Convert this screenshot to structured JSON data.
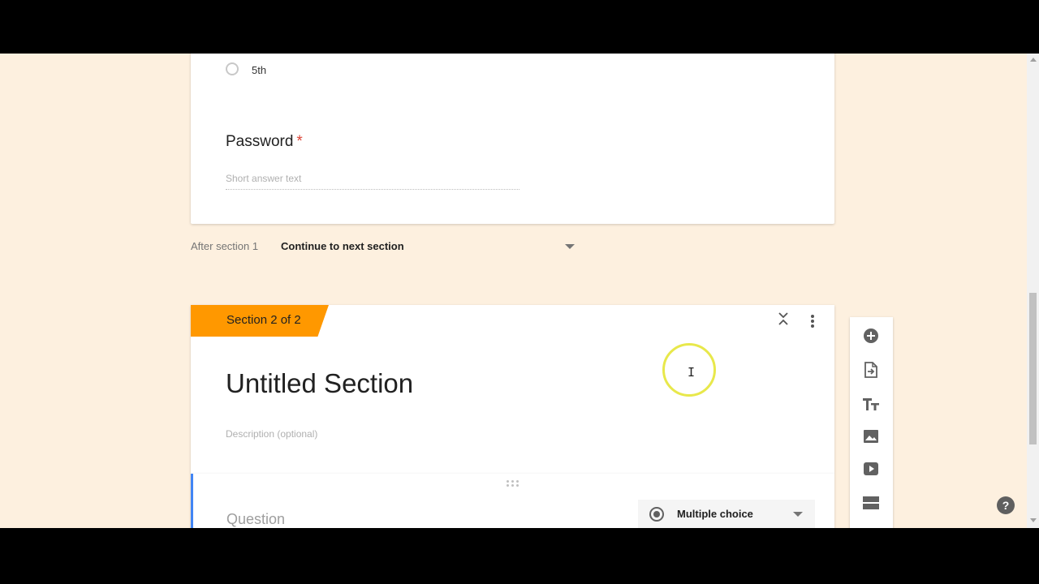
{
  "section1": {
    "option_label": "5th",
    "question_title": "Password",
    "required_mark": "*",
    "short_answer_placeholder": "Short answer text"
  },
  "navigation": {
    "after_label": "After section 1",
    "selected_action": "Continue to next section"
  },
  "section2": {
    "tab_label": "Section 2 of 2",
    "title": "Untitled Section",
    "description_placeholder": "Description (optional)"
  },
  "question": {
    "placeholder": "Question",
    "type_label": "Multiple choice"
  },
  "toolbar": {
    "buttons": [
      "add-question-icon",
      "import-questions-icon",
      "add-title-icon",
      "add-image-icon",
      "add-video-icon",
      "add-section-icon"
    ]
  },
  "colors": {
    "background": "#fdf0df",
    "section_tab": "#ff9800",
    "required": "#db4437",
    "focus": "#4285f4"
  },
  "help": {
    "label": "?"
  }
}
